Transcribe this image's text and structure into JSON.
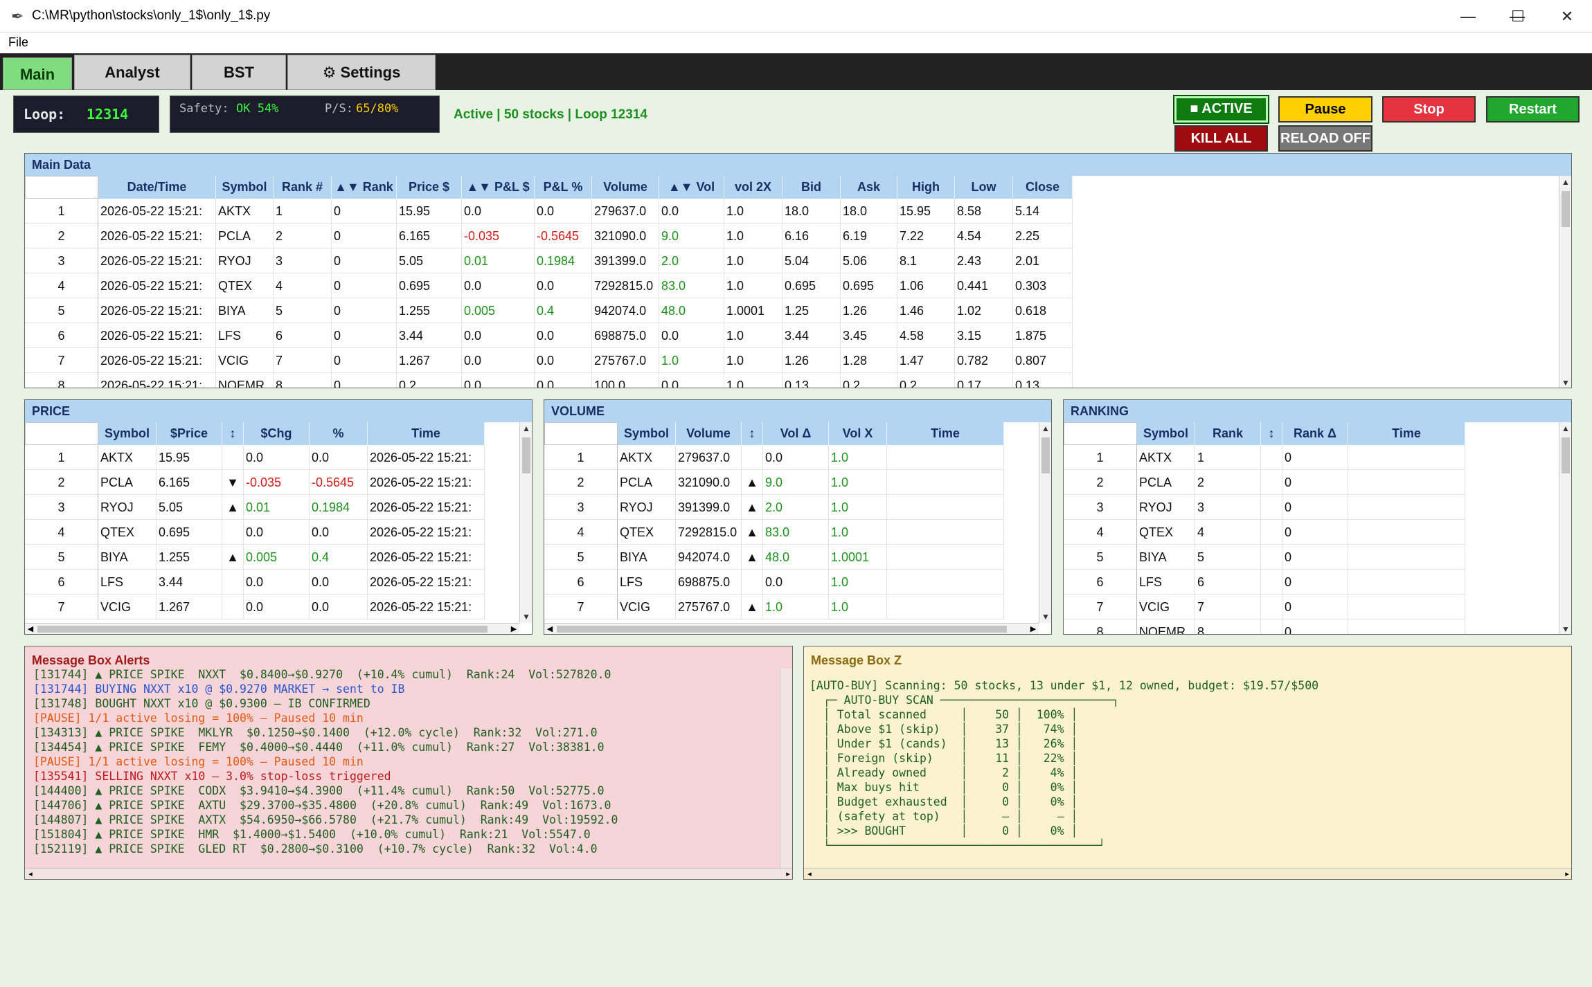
{
  "window": {
    "title": "C:\\MR\\python\\stocks\\only_1$\\only_1$.py",
    "feather_icon": "✒",
    "minimize_glyph": "—",
    "maximize_glyph": "☐",
    "close_glyph": "✕"
  },
  "menu": {
    "file": "File"
  },
  "tabs": [
    {
      "label": "Main"
    },
    {
      "label": "Analyst"
    },
    {
      "label": "BST"
    },
    {
      "label": "⚙ Settings"
    }
  ],
  "status": {
    "loop_label": "Loop:",
    "loop_value": "12314",
    "safety_label": "Safety:",
    "safety_value": "OK 54%",
    "ps_label": "P/S:",
    "ps_value": "65/80%",
    "active_text": "Active | 50 stocks | Loop 12314"
  },
  "buttons": {
    "active": "■ ACTIVE",
    "pause": "Pause",
    "stop": "Stop",
    "restart": "Restart",
    "kill_all": "KILL ALL",
    "reload": "RELOAD OFF"
  },
  "colors": {
    "positive": "#1f8f1f",
    "negative": "#d41a1a",
    "header_bg": "#b3d5f2",
    "alert_bg": "#f6d4d8",
    "z_bg": "#fdf2cf"
  },
  "main_data": {
    "title": "Main Data",
    "headers": [
      "Date/Time",
      "Symbol",
      "Rank #",
      "▲▼ Rank",
      "Price $",
      "▲▼ P&L $",
      "P&L %",
      "Volume",
      "▲▼ Vol",
      "vol 2X",
      "Bid",
      "Ask",
      "High",
      "Low",
      "Close"
    ],
    "rows": [
      [
        "1",
        "2026-05-22 15:21:",
        "AKTX",
        "1",
        "0",
        "15.95",
        "0.0",
        "0.0",
        "279637.0",
        "0.0",
        "1.0",
        "18.0",
        "18.0",
        "15.95",
        "8.58",
        "5.14"
      ],
      [
        "2",
        "2026-05-22 15:21:",
        "PCLA",
        "2",
        "0",
        "6.165",
        "-0.035",
        "-0.5645",
        "321090.0",
        "9.0",
        "1.0",
        "6.16",
        "6.19",
        "7.22",
        "4.54",
        "2.25"
      ],
      [
        "3",
        "2026-05-22 15:21:",
        "RYOJ",
        "3",
        "0",
        "5.05",
        "0.01",
        "0.1984",
        "391399.0",
        "2.0",
        "1.0",
        "5.04",
        "5.06",
        "8.1",
        "2.43",
        "2.01"
      ],
      [
        "4",
        "2026-05-22 15:21:",
        "QTEX",
        "4",
        "0",
        "0.695",
        "0.0",
        "0.0",
        "7292815.0",
        "83.0",
        "1.0",
        "0.695",
        "0.695",
        "1.06",
        "0.441",
        "0.303"
      ],
      [
        "5",
        "2026-05-22 15:21:",
        "BIYA",
        "5",
        "0",
        "1.255",
        "0.005",
        "0.4",
        "942074.0",
        "48.0",
        "1.0001",
        "1.25",
        "1.26",
        "1.46",
        "1.02",
        "0.618"
      ],
      [
        "6",
        "2026-05-22 15:21:",
        "LFS",
        "6",
        "0",
        "3.44",
        "0.0",
        "0.0",
        "698875.0",
        "0.0",
        "1.0",
        "3.44",
        "3.45",
        "4.58",
        "3.15",
        "1.875"
      ],
      [
        "7",
        "2026-05-22 15:21:",
        "VCIG",
        "7",
        "0",
        "1.267",
        "0.0",
        "0.0",
        "275767.0",
        "1.0",
        "1.0",
        "1.26",
        "1.28",
        "1.47",
        "0.782",
        "0.807"
      ],
      [
        "8",
        "2026-05-22 15:21:",
        "NOEMR",
        "8",
        "0",
        "0.2",
        "0.0",
        "0.0",
        "100.0",
        "0.0",
        "1.0",
        "0.13",
        "0.2",
        "0.2",
        "0.17",
        "0.13"
      ]
    ]
  },
  "price": {
    "title": "PRICE",
    "headers": [
      "Symbol",
      "$Price",
      "↕",
      "$Chg",
      "%",
      "Time"
    ],
    "rows": [
      [
        "1",
        "AKTX",
        "15.95",
        "",
        "0.0",
        "0.0",
        "2026-05-22 15:21:"
      ],
      [
        "2",
        "PCLA",
        "6.165",
        "▼",
        "-0.035",
        "-0.5645",
        "2026-05-22 15:21:"
      ],
      [
        "3",
        "RYOJ",
        "5.05",
        "▲",
        "0.01",
        "0.1984",
        "2026-05-22 15:21:"
      ],
      [
        "4",
        "QTEX",
        "0.695",
        "",
        "0.0",
        "0.0",
        "2026-05-22 15:21:"
      ],
      [
        "5",
        "BIYA",
        "1.255",
        "▲",
        "0.005",
        "0.4",
        "2026-05-22 15:21:"
      ],
      [
        "6",
        "LFS",
        "3.44",
        "",
        "0.0",
        "0.0",
        "2026-05-22 15:21:"
      ],
      [
        "7",
        "VCIG",
        "1.267",
        "",
        "0.0",
        "0.0",
        "2026-05-22 15:21:"
      ]
    ]
  },
  "volume": {
    "title": "VOLUME",
    "headers": [
      "Symbol",
      "Volume",
      "↕",
      "Vol Δ",
      "Vol X",
      "Time"
    ],
    "rows": [
      [
        "1",
        "AKTX",
        "279637.0",
        "",
        "0.0",
        "1.0",
        ""
      ],
      [
        "2",
        "PCLA",
        "321090.0",
        "▲",
        "9.0",
        "1.0",
        ""
      ],
      [
        "3",
        "RYOJ",
        "391399.0",
        "▲",
        "2.0",
        "1.0",
        ""
      ],
      [
        "4",
        "QTEX",
        "7292815.0",
        "▲",
        "83.0",
        "1.0",
        ""
      ],
      [
        "5",
        "BIYA",
        "942074.0",
        "▲",
        "48.0",
        "1.0001",
        ""
      ],
      [
        "6",
        "LFS",
        "698875.0",
        "",
        "0.0",
        "1.0",
        ""
      ],
      [
        "7",
        "VCIG",
        "275767.0",
        "▲",
        "1.0",
        "1.0",
        ""
      ]
    ]
  },
  "ranking": {
    "title": "RANKING",
    "headers": [
      "Symbol",
      "Rank",
      "↕",
      "Rank Δ",
      "Time"
    ],
    "rows": [
      [
        "1",
        "AKTX",
        "1",
        "",
        "0",
        ""
      ],
      [
        "2",
        "PCLA",
        "2",
        "",
        "0",
        ""
      ],
      [
        "3",
        "RYOJ",
        "3",
        "",
        "0",
        ""
      ],
      [
        "4",
        "QTEX",
        "4",
        "",
        "0",
        ""
      ],
      [
        "5",
        "BIYA",
        "5",
        "",
        "0",
        ""
      ],
      [
        "6",
        "LFS",
        "6",
        "",
        "0",
        ""
      ],
      [
        "7",
        "VCIG",
        "7",
        "",
        "0",
        ""
      ],
      [
        "8",
        "NOEMR",
        "8",
        "",
        "0",
        ""
      ]
    ]
  },
  "alerts": {
    "title": "Message Box Alerts",
    "lines": [
      {
        "text": "[131744] ▲ PRICE SPIKE  NXXT  $0.8400→$0.9270  (+10.4% cumul)  Rank:24  Vol:527820.0",
        "kind": "green"
      },
      {
        "text": "[131744] BUYING NXXT x10 @ $0.9270 MARKET → sent to IB",
        "kind": "blue"
      },
      {
        "text": "[131748] BOUGHT NXXT x10 @ $0.9300 — IB CONFIRMED",
        "kind": "green"
      },
      {
        "text": "[PAUSE] 1/1 active losing = 100% — Paused 10 min",
        "kind": "orange"
      },
      {
        "text": "[134313] ▲ PRICE SPIKE  MKLYR  $0.1250→$0.1400  (+12.0% cycle)  Rank:32  Vol:271.0",
        "kind": "green"
      },
      {
        "text": "[134454] ▲ PRICE SPIKE  FEMY  $0.4000→$0.4440  (+11.0% cumul)  Rank:27  Vol:38381.0",
        "kind": "green"
      },
      {
        "text": "[PAUSE] 1/1 active losing = 100% — Paused 10 min",
        "kind": "orange"
      },
      {
        "text": "[135541] SELLING NXXT x10 — 3.0% stop-loss triggered",
        "kind": "red"
      },
      {
        "text": "[144400] ▲ PRICE SPIKE  CODX  $3.9410→$4.3900  (+11.4% cumul)  Rank:50  Vol:52775.0",
        "kind": "green"
      },
      {
        "text": "[144706] ▲ PRICE SPIKE  AXTU  $29.3700→$35.4800  (+20.8% cumul)  Rank:49  Vol:1673.0",
        "kind": "green"
      },
      {
        "text": "[144807] ▲ PRICE SPIKE  AXTX  $54.6950→$66.5780  (+21.7% cumul)  Rank:49  Vol:19592.0",
        "kind": "green"
      },
      {
        "text": "[151804] ▲ PRICE SPIKE  HMR  $1.4000→$1.5400  (+10.0% cumul)  Rank:21  Vol:5547.0",
        "kind": "green"
      },
      {
        "text": "[152119] ▲ PRICE SPIKE  GLED RT  $0.2800→$0.3100  (+10.7% cycle)  Rank:32  Vol:4.0",
        "kind": "green"
      }
    ]
  },
  "boxz": {
    "title": "Message Box Z",
    "summary": "[AUTO-BUY] Scanning: 50 stocks, 13 under $1, 12 owned, budget: $19.57/$500",
    "scan_title": "AUTO-BUY SCAN",
    "rows": [
      {
        "label": "Total scanned",
        "count": "50",
        "pct": "100%"
      },
      {
        "label": "Above $1 (skip)",
        "count": "37",
        "pct": "74%"
      },
      {
        "label": "Under $1 (cands)",
        "count": "13",
        "pct": "26%"
      },
      {
        "label": "Foreign (skip)",
        "count": "11",
        "pct": "22%"
      },
      {
        "label": "Already owned",
        "count": "2",
        "pct": "4%"
      },
      {
        "label": "Max buys hit",
        "count": "0",
        "pct": "0%"
      },
      {
        "label": "Budget exhausted",
        "count": "0",
        "pct": "0%"
      },
      {
        "label": "(safety at top)",
        "count": "—",
        "pct": "—"
      },
      {
        "label": ">>> BOUGHT",
        "count": "0",
        "pct": "0%"
      }
    ]
  }
}
